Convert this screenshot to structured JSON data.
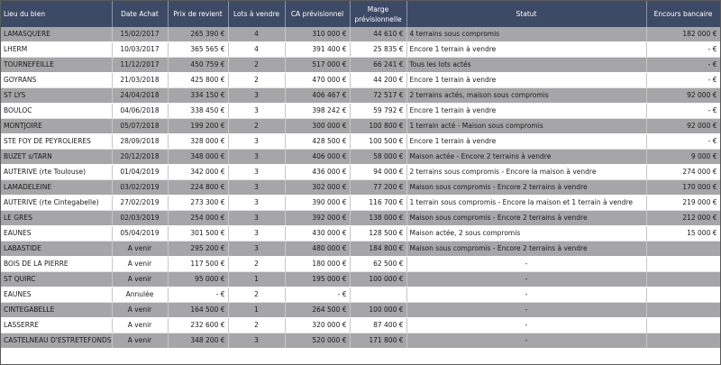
{
  "headers": [
    "Lieu du bien",
    "Date Achat",
    "Prix de revient",
    "Lots à vendre",
    "CA prévisionnel",
    "Marge prévisionnelle",
    "Statut",
    "Encours bancaire"
  ],
  "rows": [
    [
      "LAMASQUERE",
      "15/02/2017",
      "265 390 €",
      "4",
      "310 000 €",
      "44 610 €",
      "4 terrains sous compromis",
      "182 000 €"
    ],
    [
      "LHERM",
      "10/03/2017",
      "365 565 €",
      "4",
      "391 400 €",
      "25 835 €",
      "Encore 1 terrain à vendre",
      "- €"
    ],
    [
      "TOURNEFEILLE",
      "11/12/2017",
      "450 759 €",
      "2",
      "517 000 €",
      "66 241 €",
      "Tous les lots actés",
      "- €"
    ],
    [
      "GOYRANS",
      "21/03/2018",
      "425 800 €",
      "2",
      "470 000 €",
      "44 200 €",
      "Encore 1 terrain à vendre",
      "- €"
    ],
    [
      "ST LYS",
      "24/04/2018",
      "334 150 €",
      "3",
      "406 467 €",
      "72 517 €",
      "2 terrains actés, maison sous compromis",
      "92 000 €"
    ],
    [
      "BOULOC",
      "04/06/2018",
      "338 450 €",
      "3",
      "398 242 €",
      "59 792 €",
      "Encore 1 terrain à vendre",
      "- €"
    ],
    [
      "MONTJOIRE",
      "05/07/2018",
      "199 200 €",
      "2",
      "300 000 €",
      "100 800 €",
      "1 terrain acté - Maison sous compromis",
      "92 000 €"
    ],
    [
      "STE FOY DE PEYROLIERES",
      "28/09/2018",
      "328 000 €",
      "3",
      "428 500 €",
      "100 500 €",
      "Encore 1 terrain à vendre",
      "- €"
    ],
    [
      "BUZET s/TARN",
      "20/12/2018",
      "348 000 €",
      "3",
      "406 000 €",
      "58 000 €",
      "Maison actée - Encore 2 terrains à vendre",
      "9 000 €"
    ],
    [
      "AUTERIVE (rte Toulouse)",
      "01/04/2019",
      "342 000 €",
      "3",
      "436 000 €",
      "94 000 €",
      "2 terrains sous compromis - Encore la maison à vendre",
      "274 000 €"
    ],
    [
      "LAMADELEINE",
      "03/02/2019",
      "224 800 €",
      "3",
      "302 000 €",
      "77 200 €",
      "Maison sous compromis - Encore 2 terrains à vendre",
      "170 000 €"
    ],
    [
      "AUTERIVE (rte Cintegabelle)",
      "27/02/2019",
      "273 300 €",
      "3",
      "390 000 €",
      "116 700 €",
      "1 terrain sous compromis - Encore la maison et 1 terrain à vendre",
      "219 000 €"
    ],
    [
      "LE GRES",
      "02/03/2019",
      "254 000 €",
      "3",
      "392 000 €",
      "138 000 €",
      "Maison sous compromis - Encore 2 terrains à vendre",
      "212 000 €"
    ],
    [
      "EAUNES",
      "05/04/2019",
      "301 500 €",
      "3",
      "430 000 €",
      "128 500 €",
      "Maison actée, 2 sous compromis",
      "15 000 €"
    ],
    [
      "LABASTIDE",
      "A venir",
      "295 200 €",
      "3",
      "480 000 €",
      "184 800 €",
      "Maison sous compromis - Encore 2 terrains à vendre",
      ""
    ],
    [
      "BOIS DE LA PIERRE",
      "A venir",
      "117 500 €",
      "2",
      "180 000 €",
      "62 500 €",
      "-",
      ""
    ],
    [
      "ST QUIRC",
      "A venir",
      "95 000 €",
      "1",
      "195 000 €",
      "100 000 €",
      "-",
      ""
    ],
    [
      "EAUNES",
      "Annulée",
      "- €",
      "2",
      "- €",
      "",
      "-",
      ""
    ],
    [
      "CINTEGABELLE",
      "A venir",
      "164 500 €",
      "1",
      "264 500 €",
      "100 000 €",
      "-",
      ""
    ],
    [
      "LASSERRE",
      "A venir",
      "232 600 €",
      "2",
      "320 000 €",
      "87 400 €",
      "-",
      ""
    ],
    [
      "CASTELNEAU D'ESTRETEFONDS",
      "A venir",
      "348 200 €",
      "3",
      "520 000 €",
      "171 800 €",
      "-",
      ""
    ]
  ]
}
